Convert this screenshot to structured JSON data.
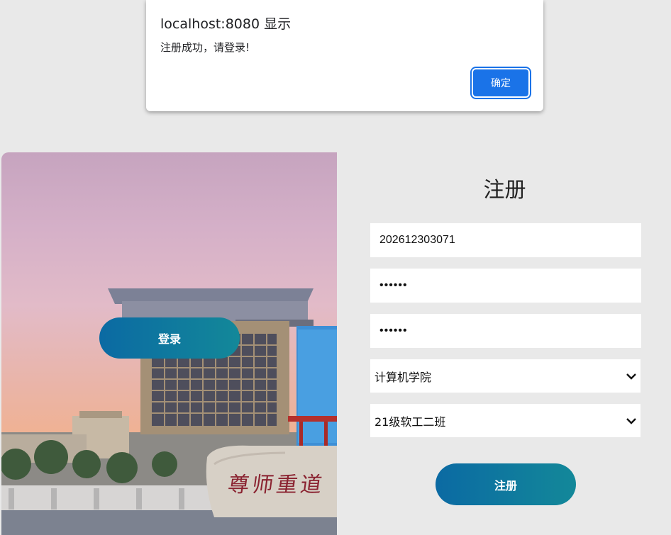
{
  "alert": {
    "title": "localhost:8080 显示",
    "message": "注册成功，请登录!",
    "ok_label": "确定"
  },
  "left_panel": {
    "login_label": "登录",
    "stone_text": "尊师重道"
  },
  "form": {
    "title": "注册",
    "username_value": "202612303071",
    "password_mask": "••••••",
    "confirm_password_mask": "••••••",
    "college_selected": "计算机学院",
    "class_selected": "21级软工二班",
    "register_label": "注册"
  },
  "colors": {
    "button_gradient_start": "#0b6aa3",
    "button_gradient_end": "#138899",
    "dialog_button": "#1a73e8",
    "page_background": "#e9e9e9"
  },
  "icons": {
    "select_arrow": "chevron-down-icon"
  }
}
